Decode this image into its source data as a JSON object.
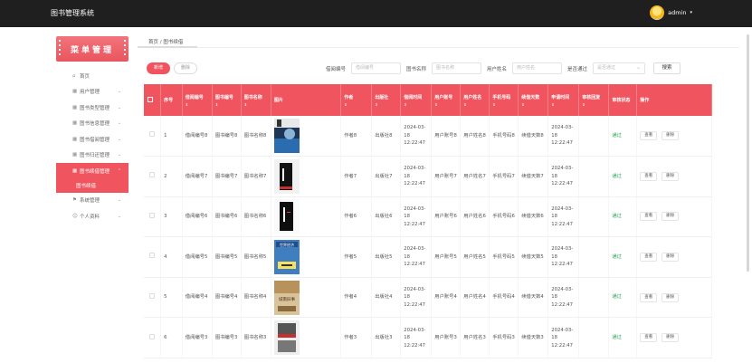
{
  "header": {
    "title": "图书管理系统",
    "username": "admin",
    "caret": "▾"
  },
  "sidebar": {
    "title": "菜单管理",
    "items": [
      {
        "icon": "home-icon",
        "label": "首页"
      },
      {
        "icon": "grid-icon",
        "label": "用户管理",
        "arrow": "⌄"
      },
      {
        "icon": "grid-icon",
        "label": "图书类型管理",
        "arrow": "⌄"
      },
      {
        "icon": "grid-icon",
        "label": "图书信息管理",
        "arrow": "⌄"
      },
      {
        "icon": "grid-icon",
        "label": "图书借阅管理",
        "arrow": "⌄"
      },
      {
        "icon": "grid-icon",
        "label": "图书归还管理",
        "arrow": "⌄"
      },
      {
        "icon": "grid-icon",
        "label": "图书续借管理",
        "arrow": "⌃",
        "active": true
      },
      {
        "icon": "",
        "label": "图书续借",
        "sub": true
      },
      {
        "icon": "flag-icon",
        "label": "系统管理",
        "arrow": "⌄"
      },
      {
        "icon": "user-icon",
        "label": "个人资料",
        "arrow": "⌄"
      }
    ]
  },
  "breadcrumb": {
    "home": "首页",
    "sep": "/",
    "current": "图书续借"
  },
  "toolbar": {
    "add_label": "新增",
    "delete_label": "删除",
    "filters": [
      {
        "label": "借阅编号",
        "placeholder": "借阅编号"
      },
      {
        "label": "图书名称",
        "placeholder": "图书名称"
      },
      {
        "label": "用户姓名",
        "placeholder": "用户姓名"
      },
      {
        "label": "是否通过",
        "placeholder": "是否通过"
      }
    ],
    "search_label": "搜索"
  },
  "table": {
    "headers": [
      "",
      "序号",
      "借阅编号",
      "图书编号",
      "图书名称",
      "图片",
      "作者",
      "出版社",
      "借阅时间",
      "用户账号",
      "用户姓名",
      "手机号码",
      "续借天数",
      "申请时间",
      "审核回复",
      "审核状态",
      "操作"
    ],
    "sort_glyph": "⇕",
    "rows": [
      {
        "idx": "1",
        "borrow_no": "借阅编号8",
        "book_no": "图书编号8",
        "book_name": "图书名称8",
        "cover": "cover-1",
        "author": "作者8",
        "publisher": "出版社8",
        "borrow_time": "2024-03-18 12:22:47",
        "account": "用户账号8",
        "user_name": "用户姓名8",
        "phone": "手机号码8",
        "days": "续借天数8",
        "apply_time": "2024-03-18 12:22:47",
        "reply": "",
        "status": "通过",
        "view": "查看",
        "del": "删除"
      },
      {
        "idx": "2",
        "borrow_no": "借阅编号7",
        "book_no": "图书编号7",
        "book_name": "图书名称7",
        "cover": "cover-2",
        "author": "作者7",
        "publisher": "出版社7",
        "borrow_time": "2024-03-18 12:22:47",
        "account": "用户账号7",
        "user_name": "用户姓名7",
        "phone": "手机号码7",
        "days": "续借天数7",
        "apply_time": "2024-03-18 12:22:47",
        "reply": "",
        "status": "通过",
        "view": "查看",
        "del": "删除"
      },
      {
        "idx": "3",
        "borrow_no": "借阅编号6",
        "book_no": "图书编号6",
        "book_name": "图书名称6",
        "cover": "cover-3",
        "author": "作者6",
        "publisher": "出版社6",
        "borrow_time": "2024-03-18 12:22:47",
        "account": "用户账号6",
        "user_name": "用户姓名6",
        "phone": "手机号码6",
        "days": "续借天数6",
        "apply_time": "2024-03-18 12:22:47",
        "reply": "",
        "status": "通过",
        "view": "查看",
        "del": "删除"
      },
      {
        "idx": "4",
        "borrow_no": "借阅编号5",
        "book_no": "图书编号5",
        "book_name": "图书名称5",
        "cover": "cover-4",
        "author": "作者5",
        "publisher": "出版社5",
        "borrow_time": "2024-03-18 12:22:47",
        "account": "用户账号5",
        "user_name": "用户姓名5",
        "phone": "手机号码5",
        "days": "续借天数5",
        "apply_time": "2024-03-18 12:22:47",
        "reply": "",
        "status": "通过",
        "view": "查看",
        "del": "删除"
      },
      {
        "idx": "5",
        "borrow_no": "借阅编号4",
        "book_no": "图书编号4",
        "book_name": "图书名称4",
        "cover": "cover-5",
        "author": "作者4",
        "publisher": "出版社4",
        "borrow_time": "2024-03-18 12:22:47",
        "account": "用户账号4",
        "user_name": "用户姓名4",
        "phone": "手机号码4",
        "days": "续借天数4",
        "apply_time": "2024-03-18 12:22:47",
        "reply": "",
        "status": "通过",
        "view": "查看",
        "del": "删除"
      },
      {
        "idx": "6",
        "borrow_no": "借阅编号3",
        "book_no": "图书编号3",
        "book_name": "图书名称3",
        "cover": "cover-6",
        "author": "作者3",
        "publisher": "出版社3",
        "borrow_time": "2024-03-18 12:22:47",
        "account": "用户账号3",
        "user_name": "用户姓名3",
        "phone": "手机号码3",
        "days": "续借天数3",
        "apply_time": "2024-03-18 12:22:47",
        "reply": "",
        "status": "通过",
        "view": "查看",
        "del": "删除"
      }
    ]
  },
  "colors": {
    "accent": "#f0555f",
    "topbar": "#1f1f1f",
    "status_ok": "#2ca45a"
  }
}
